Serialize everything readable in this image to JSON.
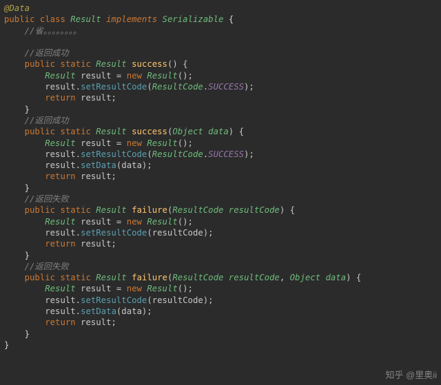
{
  "code": {
    "l1_annotation": "@Data",
    "l2_kw_public": "public",
    "l2_kw_class": "class",
    "l2_type_result": "Result",
    "l2_kw_implements": "implements",
    "l2_type_serializable": "Serializable",
    "l2_brace": "{",
    "l3_comment": "//省。。。。。。。。",
    "l5_comment": "//返回成功",
    "l6_kw_public": "public",
    "l6_kw_static": "static",
    "l6_type": "Result",
    "l6_method": "success",
    "l6_paren": "() {",
    "l7_type": "Result",
    "l7_var": " result = ",
    "l7_kw_new": "new",
    "l7_type2": " Result",
    "l7_paren": "();",
    "l8_obj": "result.",
    "l8_call": "setResultCode",
    "l8_open": "(",
    "l8_enum": "ResultCode",
    "l8_dot": ".",
    "l8_const": "SUCCESS",
    "l8_close": ");",
    "l9_kw_return": "return",
    "l9_rest": " result;",
    "l10_brace": "}",
    "l11_comment": "//返回成功",
    "l12_kw_public": "public",
    "l12_kw_static": "static",
    "l12_type": "Result",
    "l12_method": "success",
    "l12_open": "(",
    "l12_ptype": "Object",
    "l12_pname": " data",
    "l12_close": ") {",
    "l13_type": "Result",
    "l13_var": " result = ",
    "l13_kw_new": "new",
    "l13_type2": " Result",
    "l13_paren": "();",
    "l14_obj": "result.",
    "l14_call": "setResultCode",
    "l14_open": "(",
    "l14_enum": "ResultCode",
    "l14_dot": ".",
    "l14_const": "SUCCESS",
    "l14_close": ");",
    "l15_obj": "result.",
    "l15_call": "setData",
    "l15_rest": "(data);",
    "l16_kw_return": "return",
    "l16_rest": " result;",
    "l17_brace": "}",
    "l18_comment": "//返回失败",
    "l19_kw_public": "public",
    "l19_kw_static": "static",
    "l19_type": "Result",
    "l19_method": "failure",
    "l19_open": "(",
    "l19_ptype": "ResultCode",
    "l19_pname": " resultCode",
    "l19_close": ") {",
    "l20_type": "Result",
    "l20_var": " result = ",
    "l20_kw_new": "new",
    "l20_type2": " Result",
    "l20_paren": "();",
    "l21_obj": "result.",
    "l21_call": "setResultCode",
    "l21_rest": "(resultCode);",
    "l22_kw_return": "return",
    "l22_rest": " result;",
    "l23_brace": "}",
    "l24_comment": "//返回失败",
    "l25_kw_public": "public",
    "l25_kw_static": "static",
    "l25_type": "Result",
    "l25_method": "failure",
    "l25_open": "(",
    "l25_ptype1": "ResultCode",
    "l25_pname1": " resultCode",
    "l25_comma": ", ",
    "l25_ptype2": "Object",
    "l25_pname2": " data",
    "l25_close": ") {",
    "l26_type": "Result",
    "l26_var": " result = ",
    "l26_kw_new": "new",
    "l26_type2": " Result",
    "l26_paren": "();",
    "l27_obj": "result.",
    "l27_call": "setResultCode",
    "l27_rest": "(resultCode);",
    "l28_obj": "result.",
    "l28_call": "setData",
    "l28_rest": "(data);",
    "l29_kw_return": "return",
    "l29_rest": " result;",
    "l30_brace": "}",
    "l31_brace": "}"
  },
  "watermark": "知乎 @里奥ii",
  "faint_watermark": ""
}
